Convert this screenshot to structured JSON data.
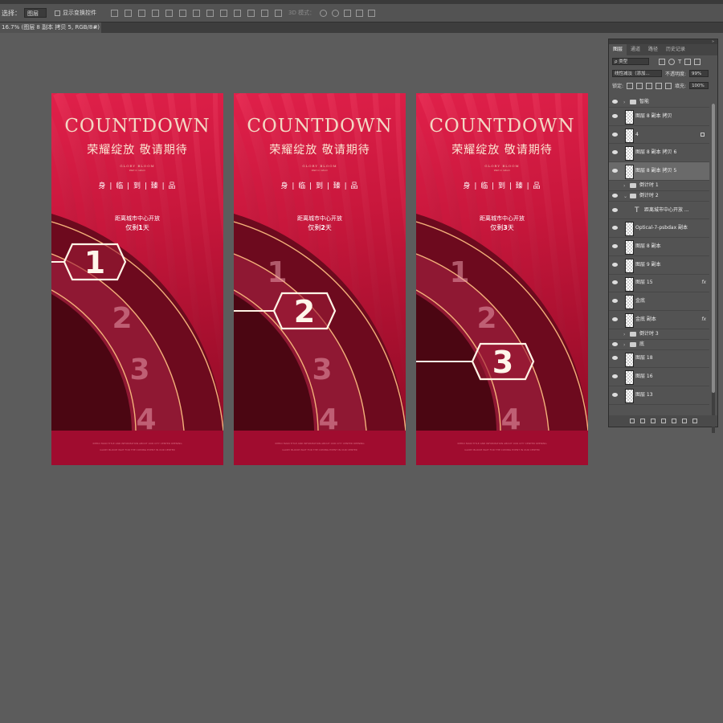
{
  "optionsBar": {
    "select_label": "选择：",
    "select_value": "图层",
    "show_transform_label": "显示变换控件",
    "mode_label": "3D 模式："
  },
  "document_tab": {
    "title": "16.7% (图层 8 副本 拷贝 5, RGB/8#) *",
    "close": "×"
  },
  "posters": [
    {
      "title": "COUNTDOWN",
      "subtitle": "荣耀绽放 敬请期待",
      "glory": "GLORY BLOOM",
      "glory_small": "Wait in return",
      "tagline": "身 | 临 | 到 | 臻 | 品",
      "distance": "距离城市中心开放",
      "remain_prefix": "仅剩",
      "remain_number": "1",
      "remain_suffix": "天",
      "active_number": 1,
      "foot_line1": "INTRO MAIN TITLE AND INFORMATION ABOUT OUR CITY CENTER OPENING",
      "foot_line2": "GLORY BLOOM WAIT FOR THE COMING EVENT IN OUR CENTER"
    },
    {
      "title": "COUNTDOWN",
      "subtitle": "荣耀绽放 敬请期待",
      "glory": "GLORY BLOOM",
      "glory_small": "Wait in return",
      "tagline": "身 | 临 | 到 | 臻 | 品",
      "distance": "距离城市中心开放",
      "remain_prefix": "仅剩",
      "remain_number": "2",
      "remain_suffix": "天",
      "active_number": 2,
      "foot_line1": "INTRO MAIN TITLE AND INFORMATION ABOUT OUR CITY CENTER OPENING",
      "foot_line2": "GLORY BLOOM WAIT FOR THE COMING EVENT IN OUR CENTER"
    },
    {
      "title": "COUNTDOWN",
      "subtitle": "荣耀绽放 敬请期待",
      "glory": "GLORY BLOOM",
      "glory_small": "Wait in return",
      "tagline": "身 | 临 | 到 | 臻 | 品",
      "distance": "距离城市中心开放",
      "remain_prefix": "仅剩",
      "remain_number": "3",
      "remain_suffix": "天",
      "active_number": 3,
      "foot_line1": "INTRO MAIN TITLE AND INFORMATION ABOUT OUR CITY CENTER OPENING",
      "foot_line2": "GLORY BLOOM WAIT FOR THE COMING EVENT IN OUR CENTER"
    }
  ],
  "panel": {
    "tabs": [
      "图层",
      "通道",
      "路径",
      "历史记录"
    ],
    "filter_label": "ρ 类型",
    "blend_mode": "线性减淡（添加...",
    "opacity_label": "不透明度:",
    "opacity_value": "99%",
    "lock_label": "锁定:",
    "fill_label": "填充:",
    "fill_value": "100%",
    "layers": [
      {
        "name": "智能",
        "kind": "top"
      },
      {
        "name": "图层 8 副本 拷贝",
        "kind": "layer"
      },
      {
        "name": "4",
        "kind": "layer",
        "locked": true
      },
      {
        "name": "图层 8 副本 拷贝 6",
        "kind": "layer"
      },
      {
        "name": "图层 8 副本 拷贝 5",
        "kind": "layer",
        "selected": true
      },
      {
        "name": "倒计时 1",
        "kind": "group"
      },
      {
        "name": "倒计时 2",
        "kind": "group",
        "open": true
      },
      {
        "name": "距离城市中心开放 ...",
        "kind": "text"
      },
      {
        "name": "Optical-7-psbdax 副本",
        "kind": "layer"
      },
      {
        "name": "图层 8 副本",
        "kind": "layer"
      },
      {
        "name": "图层 9 副本",
        "kind": "layer"
      },
      {
        "name": "图层 15",
        "kind": "layer",
        "fx": true
      },
      {
        "name": "金底",
        "kind": "layer"
      },
      {
        "name": "金底 副本",
        "kind": "layer",
        "fx": true
      },
      {
        "name": "倒计时 3",
        "kind": "group"
      },
      {
        "name": "底",
        "kind": "group"
      },
      {
        "name": "图层 18",
        "kind": "layer"
      },
      {
        "name": "图层 16",
        "kind": "layer"
      },
      {
        "name": "图层 13",
        "kind": "layer"
      }
    ],
    "fx_label": "fx",
    "footer_icons": [
      "link-icon",
      "fx-icon",
      "mask-icon",
      "adjustment-icon",
      "folder-icon",
      "new-layer-icon",
      "trash-icon"
    ]
  }
}
